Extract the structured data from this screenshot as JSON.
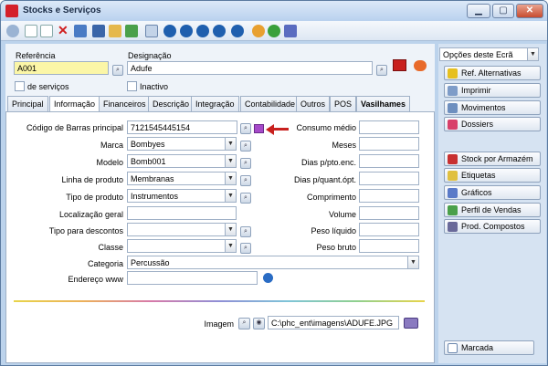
{
  "window": {
    "title": "Stocks e Serviços"
  },
  "header": {
    "referencia_label": "Referência",
    "referencia_value": "A001",
    "designacao_label": "Designação",
    "designacao_value": "Adufe",
    "servicos_label": "de serviços",
    "inactivo_label": "Inactivo"
  },
  "tabs": [
    "Principal",
    "Informação",
    "Financeiros",
    "Descrição",
    "Integração",
    "Contabilidade",
    "Outros",
    "POS",
    "Vasilhames"
  ],
  "form": {
    "codigo_label": "Código de Barras principal",
    "codigo_value": "7121545445154",
    "marca_label": "Marca",
    "marca_value": "Bombyes",
    "modelo_label": "Modelo",
    "modelo_value": "Bomb001",
    "linha_label": "Linha de produto",
    "linha_value": "Membranas",
    "tipo_label": "Tipo de produto",
    "tipo_value": "Instrumentos",
    "localizacao_label": "Localização geral",
    "localizacao_value": "",
    "descontos_label": "Tipo para descontos",
    "descontos_value": "",
    "classe_label": "Classe",
    "classe_value": "",
    "categoria_label": "Categoria",
    "categoria_value": "Percussão",
    "endereco_label": "Endereço www",
    "endereco_value": "",
    "consumo_label": "Consumo médio",
    "meses_label": "Meses",
    "dias_pto_label": "Dias p/pto.enc.",
    "dias_quant_label": "Dias p/quant.ópt.",
    "comprimento_label": "Comprimento",
    "volume_label": "Volume",
    "peso_liquido_label": "Peso líquido",
    "peso_bruto_label": "Peso bruto",
    "imagem_label": "Imagem",
    "imagem_value": "C:\\phc_ent\\imagens\\ADUFE.JPG"
  },
  "sidebar": {
    "options_label": "Opções deste Ecrã",
    "buttons": [
      "Ref. Alternativas",
      "Imprimir",
      "Movimentos",
      "Dossiers",
      "Stock por Armazém",
      "Etiquetas",
      "Gráficos",
      "Perfil de Vendas",
      "Prod. Compostos"
    ],
    "marcada_label": "Marcada"
  },
  "colors": {
    "yellow_field": "#fbf6a7",
    "arrow": "#c8201e",
    "accent": "#d4202a"
  }
}
